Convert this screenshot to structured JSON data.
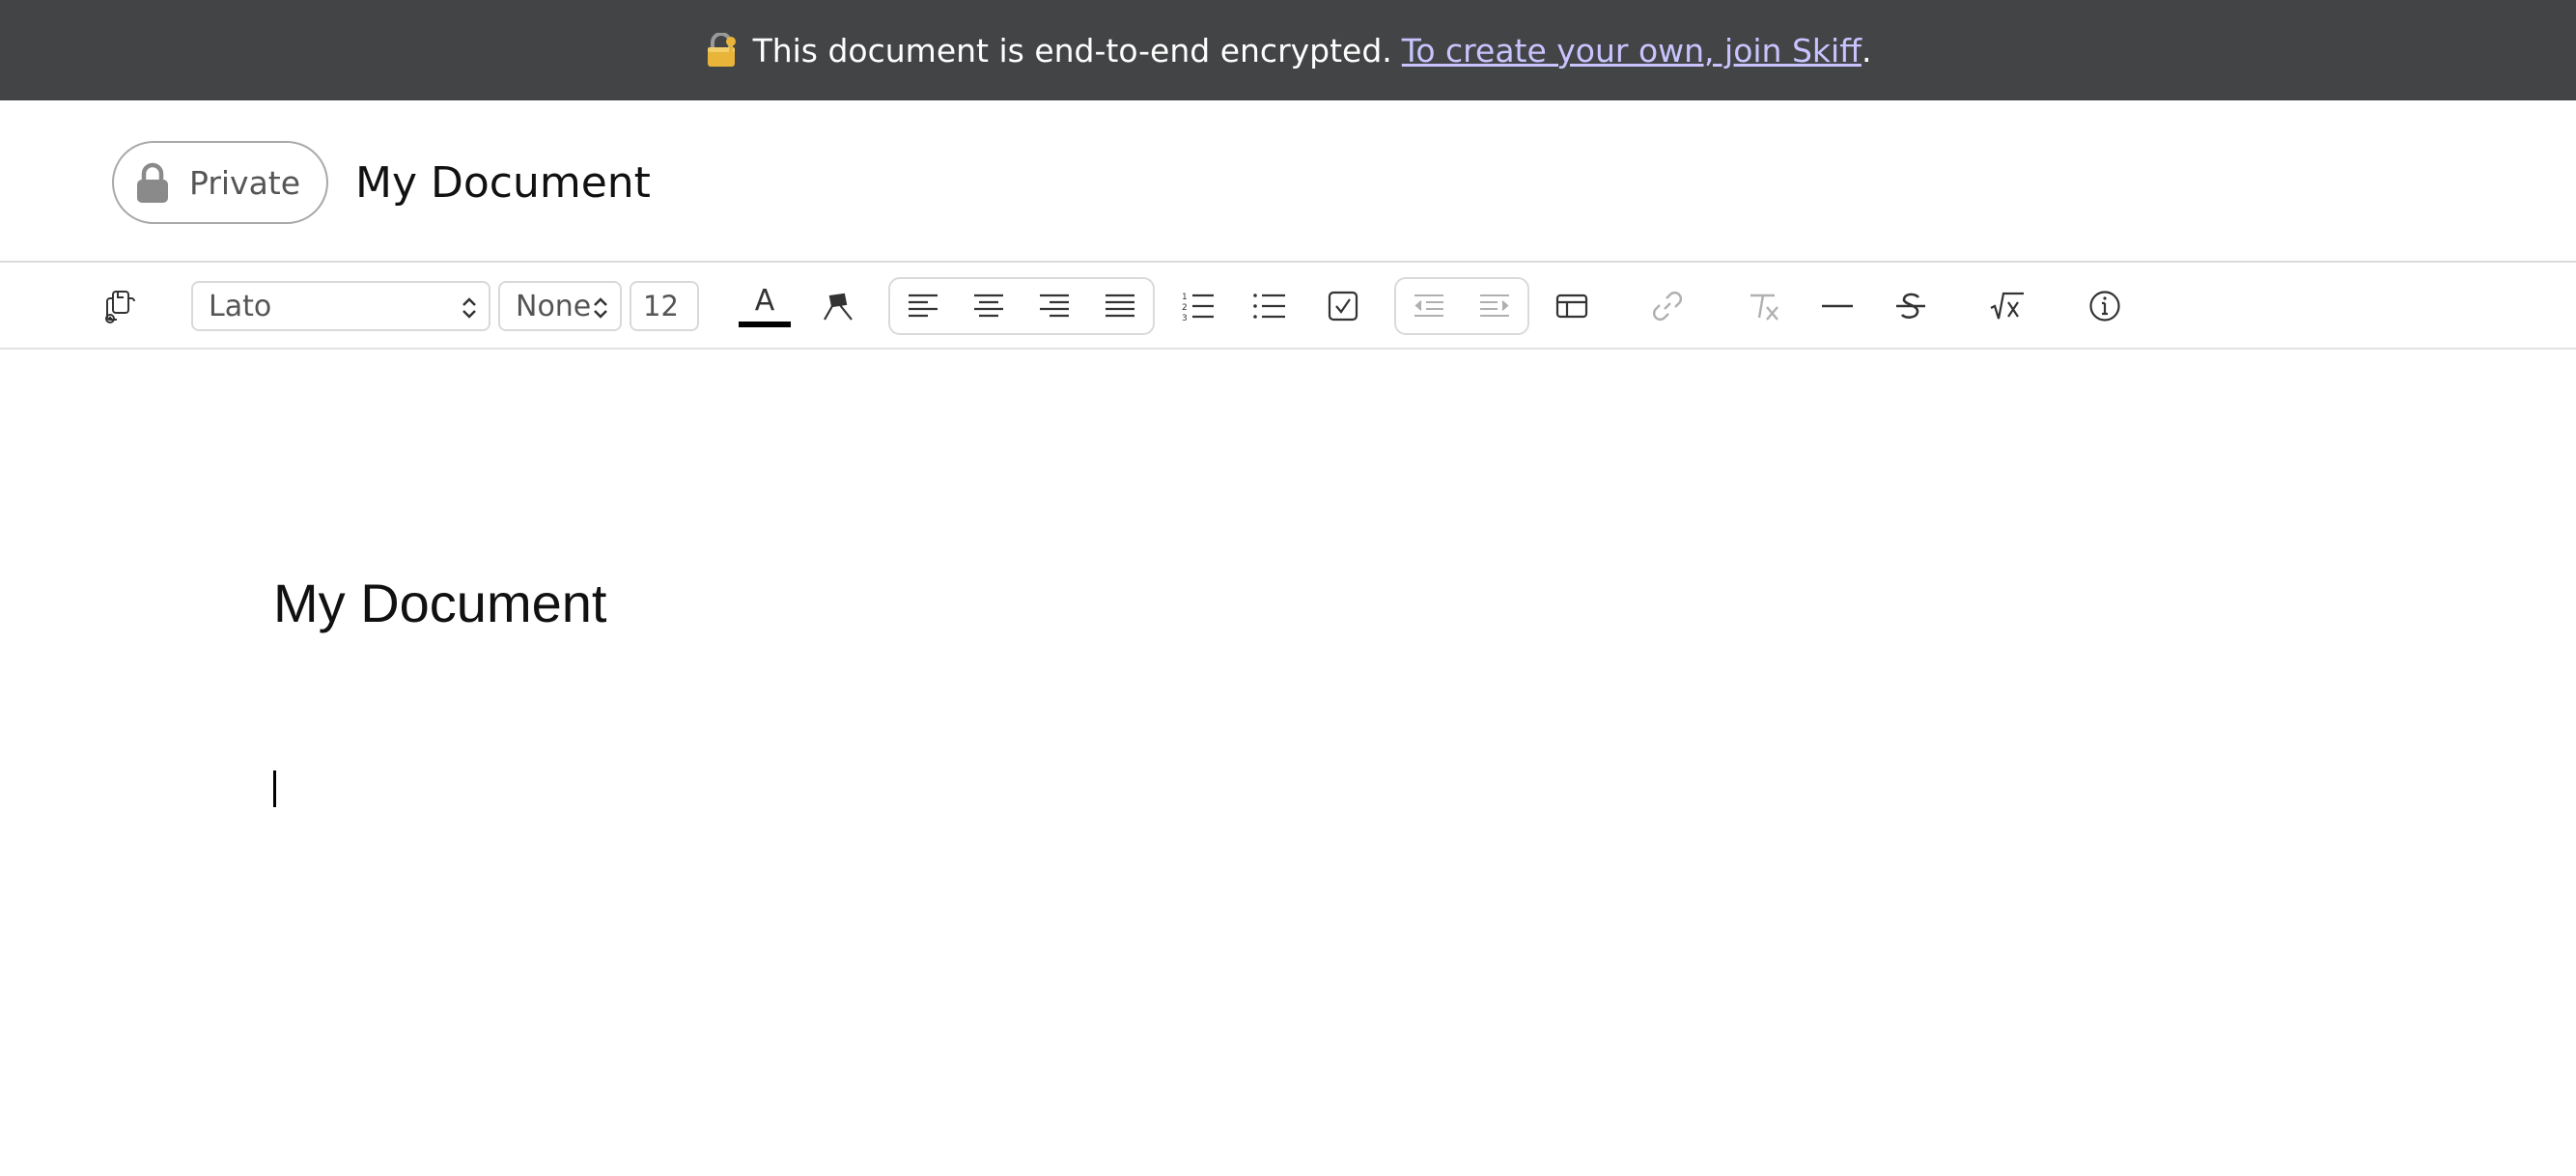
{
  "banner": {
    "icon": "locked-with-key-icon",
    "text": "This document is end-to-end encrypted.",
    "link_text": "To create your own, join Skiff",
    "trailing": "."
  },
  "header": {
    "privacy_label": "Private",
    "title": "My Document"
  },
  "toolbar": {
    "font_family": "Lato",
    "heading_style": "None",
    "font_size": "12",
    "text_color_glyph": "A"
  },
  "editor": {
    "title": "My Document"
  },
  "colors": {
    "banner_bg": "#434446",
    "link": "#c9c4ff",
    "icon": "#333333",
    "icon_disabled": "#b0b0b0"
  }
}
